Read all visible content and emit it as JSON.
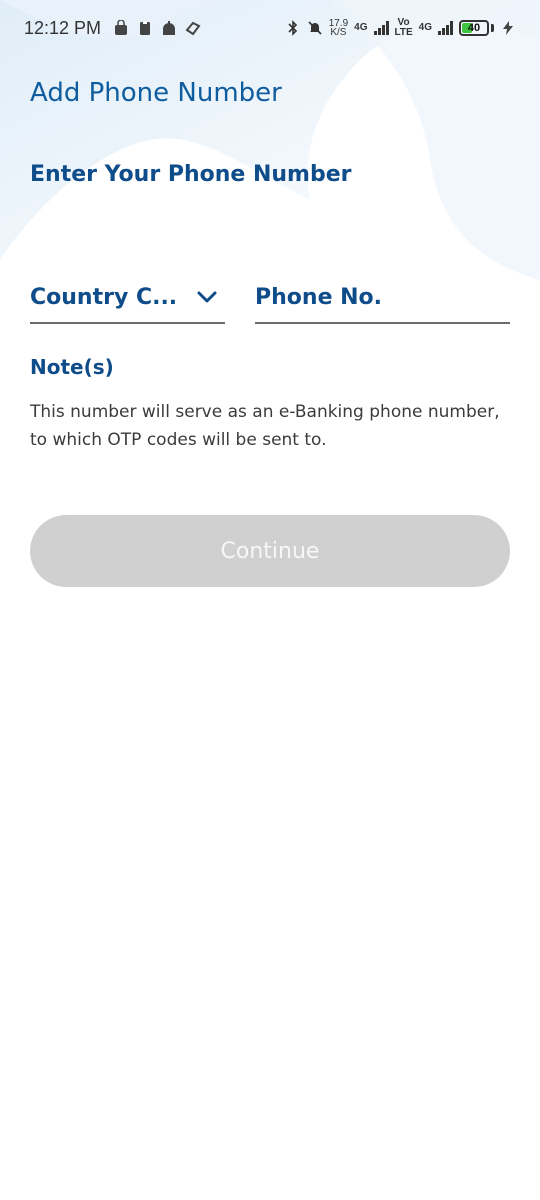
{
  "status_bar": {
    "time": "12:12 PM",
    "speed_value": "17.9",
    "speed_unit": "K/S",
    "net1": "4G",
    "volte_top": "Vo",
    "volte_bottom": "LTE",
    "net2": "4G",
    "battery": "40",
    "icons": [
      "shopping-bag-icon",
      "clipboard-icon",
      "mosque-icon",
      "app-logo-icon",
      "bluetooth-icon",
      "bell-muted-icon",
      "signal-icon",
      "charging-icon"
    ]
  },
  "page": {
    "title": "Add Phone Number",
    "section_title": "Enter Your Phone Number",
    "country_placeholder": "Country C...",
    "phone_placeholder": "Phone No.",
    "note_title": "Note(s)",
    "note_text": "This number will serve as an e-Banking phone number, to which OTP codes will be sent to.",
    "continue_label": "Continue"
  },
  "colors": {
    "primary_text": "#0f4c8a",
    "button_disabled": "#d0d0d0",
    "battery_green": "#3ec43e"
  }
}
